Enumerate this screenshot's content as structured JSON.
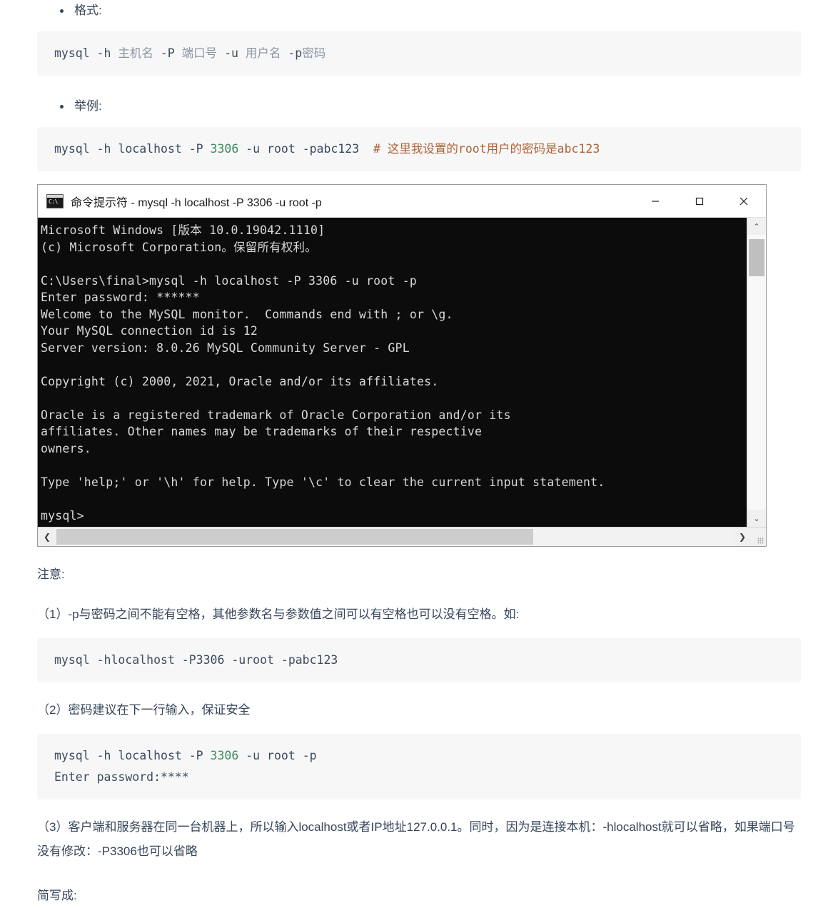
{
  "sections": {
    "format_bullet": "格式:",
    "example_bullet": "举例:"
  },
  "code_format": {
    "cmd": "mysql -h ",
    "host_ph": "主机名",
    "p_flag": " -P ",
    "port_ph": "端口号",
    "u_flag": " -u ",
    "user_ph": "用户名",
    "pw_flag": " -p",
    "pw_ph": "密码"
  },
  "code_example": {
    "pre": "mysql -h localhost -P ",
    "port": "3306",
    "post": " -u root -pabc123  ",
    "comment": "# 这里我设置的root用户的密码是abc123"
  },
  "cmd_window": {
    "title": "命令提示符 - mysql  -h localhost -P 3306 -u root -p",
    "icon": "cmd-prompt-icon",
    "minimize_glyph": "minimize-icon",
    "maximize_glyph": "maximize-icon",
    "close_glyph": "close-icon",
    "lines": [
      "Microsoft Windows [版本 10.0.19042.1110]",
      "(c) Microsoft Corporation。保留所有权利。",
      "",
      "C:\\Users\\final>mysql -h localhost -P 3306 -u root -p",
      "Enter password: ******",
      "Welcome to the MySQL monitor.  Commands end with ; or \\g.",
      "Your MySQL connection id is 12",
      "Server version: 8.0.26 MySQL Community Server - GPL",
      "",
      "Copyright (c) 2000, 2021, Oracle and/or its affiliates.",
      "",
      "Oracle is a registered trademark of Oracle Corporation and/or its",
      "affiliates. Other names may be trademarks of their respective",
      "owners.",
      "",
      "Type 'help;' or '\\h' for help. Type '\\c' to clear the current input statement.",
      "",
      "mysql>"
    ],
    "scroll": {
      "up_arrow": "⌃",
      "down_arrow": "⌄",
      "left_arrow": "❮",
      "right_arrow": "❯"
    }
  },
  "notes": {
    "heading": "注意:",
    "item1": "（1）-p与密码之间不能有空格，其他参数名与参数值之间可以有空格也可以没有空格。如:",
    "item2": "（2）密码建议在下一行输入，保证安全",
    "item3": "（3）客户端和服务器在同一台机器上，所以输入localhost或者IP地址127.0.0.1。同时，因为是连接本机：-hlocalhost就可以省略，如果端口号没有修改：-P3306也可以省略"
  },
  "code_short": {
    "line": "mysql -hlocalhost -P3306 -uroot -pabc123"
  },
  "code_nextline": {
    "pre": "mysql -h localhost -P ",
    "port": "3306",
    "post": " -u root -p",
    "line2": "Enter password:****"
  },
  "footer": {
    "text": "简写成:"
  },
  "colors": {
    "code_bg": "#f7f7f8",
    "code_fg": "#3b4a5f",
    "number": "#3d8b60",
    "comment": "#ae6336",
    "terminal_bg": "#0c0c0c",
    "terminal_fg": "#d8d8d8"
  }
}
